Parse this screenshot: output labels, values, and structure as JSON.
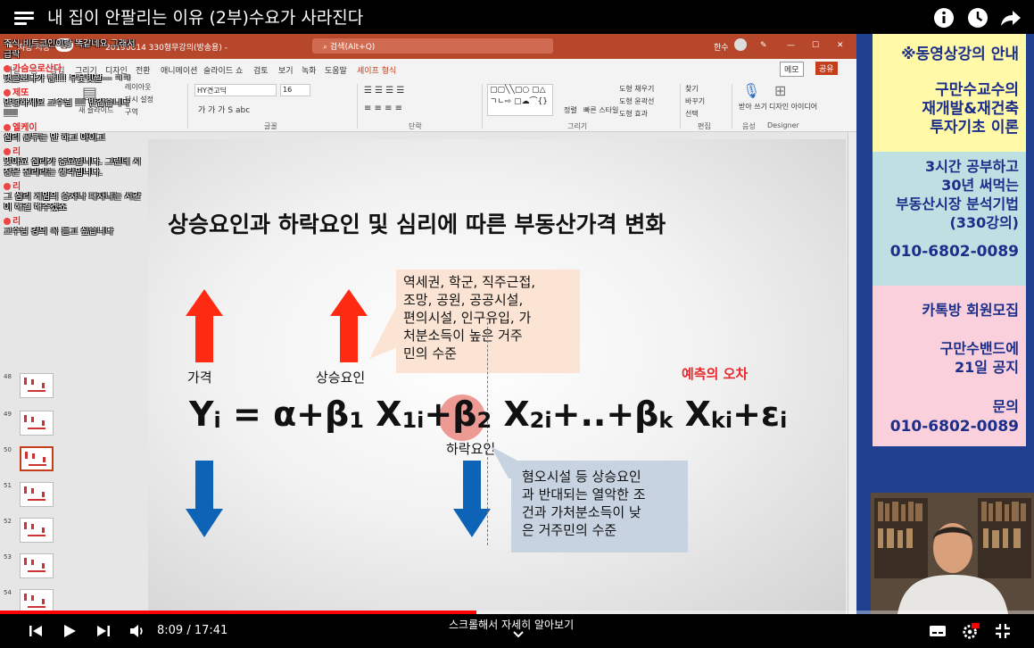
{
  "video": {
    "title": "내 집이 안팔리는 이유 (2부)수요가 사라진다"
  },
  "ppt": {
    "autosave": "자동 저장",
    "autosave_toggle": "끔",
    "filename": "20190814 330형무강의(방송용) -",
    "search_placeholder": "검색(Alt+Q)",
    "user": "한수",
    "menu": [
      "파일",
      "홈",
      "삽입",
      "그리기",
      "디자인",
      "전환",
      "애니메이션",
      "슬라이드 쇼",
      "검토",
      "보기",
      "녹화",
      "도움말",
      "셰이프 형식"
    ],
    "memo": "메모",
    "share": "공유",
    "ribbon": {
      "font_name": "HY견고딕",
      "font_size": "16",
      "layout": "레이아웃",
      "reset": "다시 설정",
      "section": "구역",
      "new_slide": "새 슬라이드",
      "font_group": "글꼴",
      "paragraph_group": "단락",
      "drawing_group": "그리기",
      "editing_group": "편집",
      "voice_group": "음성",
      "designer_group": "Designer",
      "arrange": "정렬",
      "quick_styles": "빠른 스타일",
      "shape_fill": "도형 채우기",
      "shape_outline": "도형 윤곽선",
      "shape_effects": "도형 효과",
      "find": "찾기",
      "replace": "바꾸기",
      "select": "선택",
      "dictate": "받아 쓰기",
      "design_ideas": "디자인 아이디어"
    },
    "thumbnails": [
      {
        "num": "48",
        "selected": false
      },
      {
        "num": "49",
        "selected": false
      },
      {
        "num": "50",
        "selected": true
      },
      {
        "num": "51",
        "selected": false
      },
      {
        "num": "52",
        "selected": false
      },
      {
        "num": "53",
        "selected": false
      },
      {
        "num": "54",
        "selected": false
      }
    ]
  },
  "chat": [
    {
      "name": "",
      "msg": "주식 비트코인이랑 똑같네요 그래서"
    },
    {
      "name": "",
      "msg": "급락"
    },
    {
      "name": "가슴으로산다",
      "msg": "댓글보다가 빵!!! 우웃빗짤--- ㅋㅋ"
    },
    {
      "name": "제또",
      "msg": "안녕하세요 교수님 !!! 반갑습니다"
    },
    {
      "name": "",
      "msg": "!!!!"
    },
    {
      "name": "엘케이",
      "msg": "심리 공부는 안 하고 아이고"
    },
    {
      "name": "리",
      "msg": "맞아요 심리가 중요합니다. 그런데 시"
    },
    {
      "name": "",
      "msg": "장은 진리라는 생각입니다."
    },
    {
      "name": "리",
      "msg": "그 심리 게임의 승자나 패자냐는 시간"
    },
    {
      "name": "",
      "msg": "이 해결 해주겠죠"
    },
    {
      "name": "리",
      "msg": "교수님 강의 꼭 듣고 싶습니다"
    }
  ],
  "slide": {
    "title": "상승요인과 하락요인 및 심리에 따른 부동산가격 변화",
    "label_price": "가격",
    "label_up_factor": "상승요인",
    "label_down_factor": "하락요인",
    "label_error": "예측의 오차",
    "callout_up": [
      "역세권, 학군, 직주근접,",
      "조망, 공원, 공공시설,",
      "편의시설, 인구유입, 가",
      "처분소득이 높은 거주",
      "민의 수준"
    ],
    "callout_down": [
      "혐오시설 등 상승요인",
      "과 반대되는 열악한 조",
      "건과 가처분소득이 낮",
      "은 거주민의 수준"
    ],
    "formula": {
      "y": "Y",
      "y_sub": "i",
      "eq": " = α+β",
      "b1_sub": "1",
      "x1": " X",
      "x1_sub": "1i",
      "plus_b2": "+β",
      "b2_sub": "2",
      "x2": " X",
      "x2_sub": "2i",
      "mid": "+..+β",
      "bk_sub": "k",
      "xk": " X",
      "xk_sub": "ki",
      "eps": "+ε",
      "eps_sub": "i"
    },
    "colors": {
      "up_arrow": "#ff2a12",
      "down_arrow": "#0d63b5"
    }
  },
  "banner": {
    "heading": "※동영상강의 안내",
    "course1": [
      "구만수교수의",
      "재개발&재건축",
      "투자기초 이론"
    ],
    "course2": [
      "3시간 공부하고",
      "30년 써먹는",
      "부동산시장 분석기법",
      "(330강의)"
    ],
    "phone1": "010-6802-0089",
    "kakao": "카톡방 회원모집",
    "band": [
      "구만수밴드에",
      "21일 공지"
    ],
    "inquiry": "문의",
    "phone2": "010-6802-0089"
  },
  "player": {
    "time_current": "8:09",
    "time_total": "17:41",
    "time_display": "8:09 / 17:41",
    "progress": 0.461,
    "scroll_hint": "스크롤해서 자세히 알아보기"
  }
}
